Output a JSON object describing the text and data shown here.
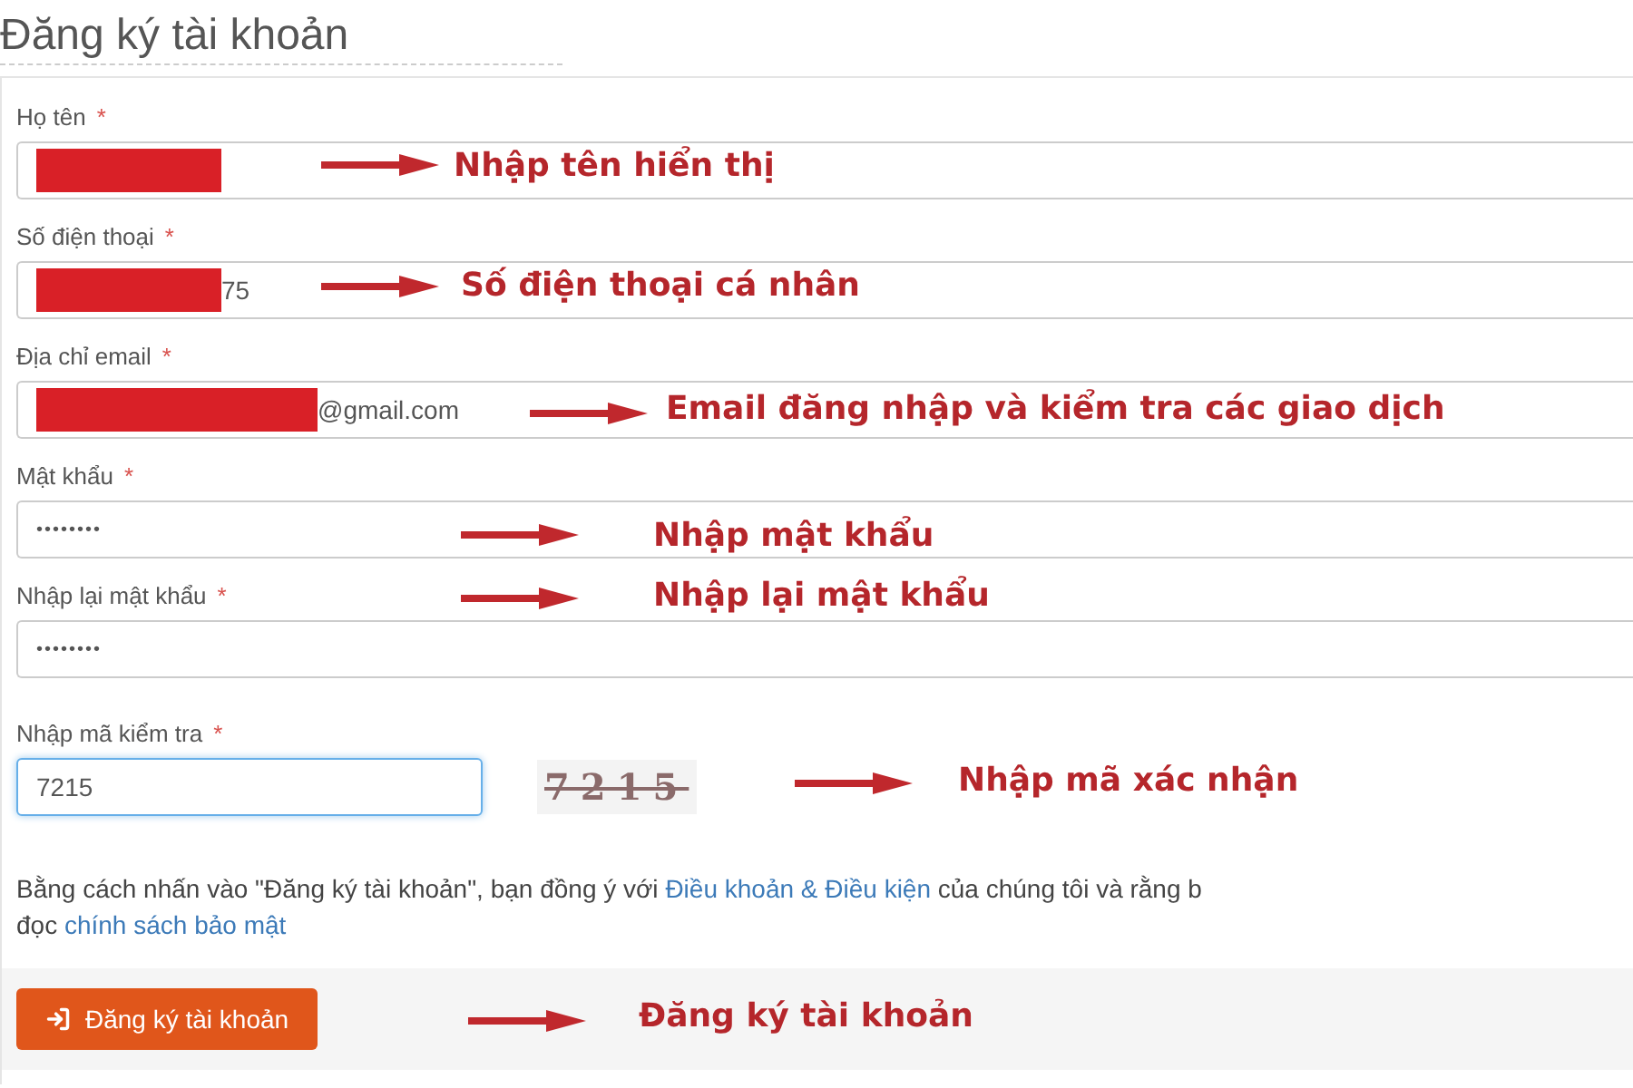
{
  "page_title": "Đăng ký tài khoản",
  "fields": [
    {
      "kind": "text",
      "label": "Họ tên",
      "required_mark": "*",
      "redacted": true,
      "focused": false
    },
    {
      "kind": "text",
      "label": "Số điện thoại",
      "required_mark": "*",
      "redacted": true,
      "value": "75",
      "focused": false
    },
    {
      "kind": "text",
      "label": "Địa chỉ email",
      "required_mark": "*",
      "redacted": true,
      "value": "@gmail.com",
      "focused": false
    },
    {
      "kind": "password",
      "label": "Mật khẩu",
      "required_mark": "*",
      "value": "••••••••",
      "focused": false
    },
    {
      "kind": "password",
      "label": "Nhập lại mật khẩu",
      "required_mark": "*",
      "value": "••••••••",
      "focused": false
    },
    {
      "kind": "captcha",
      "label": "Nhập mã kiểm tra",
      "required_mark": "*",
      "value": "7215",
      "captcha": "7215",
      "focused": true
    }
  ],
  "consent": {
    "before": "Bằng cách nhấn vào \"Đăng ký tài khoản\", bạn đồng ý với",
    "terms_link": "Điều khoản & Điều kiện",
    "after": "của chúng tôi và rằng b",
    "line2_before": "đọc",
    "privacy_link": "chính sách bảo mật"
  },
  "submit_button": "Đăng ký tài khoản",
  "annotations": [
    {
      "text": "Nhập tên hiển thị"
    },
    {
      "text": "Số điện thoại cá nhân"
    },
    {
      "text": "Email đăng nhập và kiểm tra các giao dịch"
    },
    {
      "text": "Nhập mật khẩu"
    },
    {
      "text": "Nhập lại mật khẩu"
    },
    {
      "text": "Nhập mã xác nhận"
    },
    {
      "text": "Đăng ký tài khoản"
    }
  ]
}
